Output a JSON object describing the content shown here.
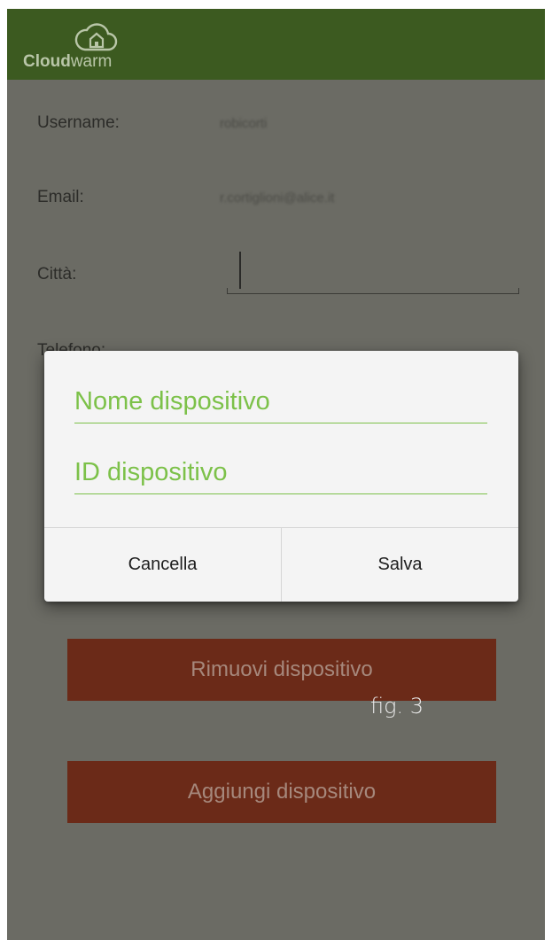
{
  "app": {
    "logo_text_bold": "Cloud",
    "logo_text_light": "warm",
    "brand_color": "#3c5a20",
    "accent_color": "#7cc149"
  },
  "profile": {
    "username_label": "Username:",
    "username_value": "robicorti",
    "email_label": "Email:",
    "email_value": "r.cortiglioni@alice.it",
    "city_label": "Città:",
    "phone_label": "Telefono:"
  },
  "buttons": {
    "remove_device": "Rimuovi dispositivo",
    "add_device": "Aggiungi dispositivo"
  },
  "dialog": {
    "device_name_placeholder": "Nome dispositivo",
    "device_id_placeholder": "ID dispositivo",
    "cancel_label": "Cancella",
    "save_label": "Salva"
  },
  "caption": "fig. 3"
}
